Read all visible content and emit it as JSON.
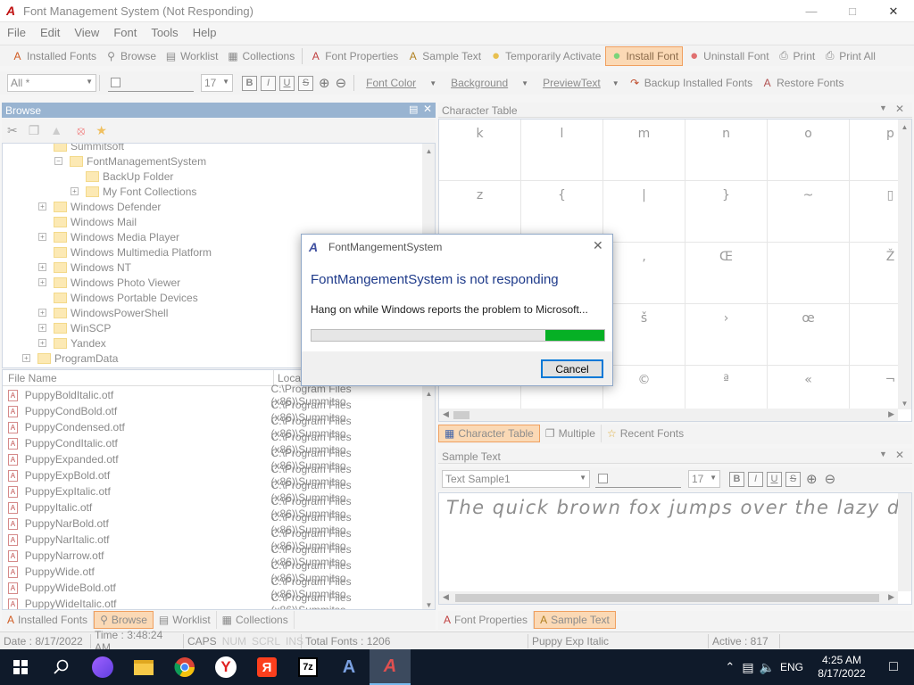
{
  "window": {
    "title": "Font Management System (Not Responding)",
    "app_icon_glyph": "A"
  },
  "menu": [
    "File",
    "Edit",
    "View",
    "Font",
    "Tools",
    "Help"
  ],
  "toolbar1": [
    {
      "label": "Installed Fonts",
      "icon": "A",
      "name": "installed-fonts"
    },
    {
      "label": "Browse",
      "icon": "🔍",
      "name": "browse"
    },
    {
      "label": "Worklist",
      "icon": "▤",
      "name": "worklist"
    },
    {
      "label": "Collections",
      "icon": "▦",
      "name": "collections"
    },
    {
      "label": "Font Properties",
      "icon": "A",
      "name": "font-properties"
    },
    {
      "label": "Sample Text",
      "icon": "A",
      "name": "sample-text"
    },
    {
      "label": "Temporarily Activate",
      "icon": "●",
      "name": "temporarily-activate"
    },
    {
      "label": "Install Font",
      "icon": "●",
      "name": "install-font"
    },
    {
      "label": "Uninstall Font",
      "icon": "●",
      "name": "uninstall-font"
    },
    {
      "label": "Print",
      "icon": "⎙",
      "name": "print"
    },
    {
      "label": "Print All",
      "icon": "⎙",
      "name": "print-all"
    }
  ],
  "toolbar2": {
    "filter_value": "All *",
    "size_value": "17",
    "format_buttons": [
      "B",
      "I",
      "U",
      "S"
    ],
    "font_color": "Font Color",
    "background": "Background",
    "preview_text": "PreviewText",
    "backup": "Backup Installed Fonts",
    "restore": "Restore Fonts"
  },
  "browse_panel": {
    "title": "Browse",
    "tree": [
      {
        "label": "Summitsoft",
        "indent": 0,
        "pm": ""
      },
      {
        "label": "FontManagementSystem",
        "indent": 1,
        "pm": "−"
      },
      {
        "label": "BackUp Folder",
        "indent": 2,
        "pm": ""
      },
      {
        "label": "My Font Collections",
        "indent": 2,
        "pm": "+"
      },
      {
        "label": "Windows Defender",
        "indent": 0,
        "pm": "+"
      },
      {
        "label": "Windows Mail",
        "indent": 0,
        "pm": ""
      },
      {
        "label": "Windows Media Player",
        "indent": 0,
        "pm": "+"
      },
      {
        "label": "Windows Multimedia Platform",
        "indent": 0,
        "pm": ""
      },
      {
        "label": "Windows NT",
        "indent": 0,
        "pm": "+"
      },
      {
        "label": "Windows Photo Viewer",
        "indent": 0,
        "pm": "+"
      },
      {
        "label": "Windows Portable Devices",
        "indent": 0,
        "pm": ""
      },
      {
        "label": "WindowsPowerShell",
        "indent": 0,
        "pm": "+"
      },
      {
        "label": "WinSCP",
        "indent": 0,
        "pm": "+"
      },
      {
        "label": "Yandex",
        "indent": 0,
        "pm": "+"
      },
      {
        "label": "ProgramData",
        "indent": -1,
        "pm": "+"
      }
    ]
  },
  "file_list": {
    "headers": [
      "File Name",
      "Locat"
    ],
    "rows": [
      {
        "name": "PuppyBoldItalic.otf",
        "path": "C:\\Program Files (x86)\\Summitso"
      },
      {
        "name": "PuppyCondBold.otf",
        "path": "C:\\Program Files (x86)\\Summitso"
      },
      {
        "name": "PuppyCondensed.otf",
        "path": "C:\\Program Files (x86)\\Summitso"
      },
      {
        "name": "PuppyCondItalic.otf",
        "path": "C:\\Program Files (x86)\\Summitso"
      },
      {
        "name": "PuppyExpanded.otf",
        "path": "C:\\Program Files (x86)\\Summitso"
      },
      {
        "name": "PuppyExpBold.otf",
        "path": "C:\\Program Files (x86)\\Summitso"
      },
      {
        "name": "PuppyExpItalic.otf",
        "path": "C:\\Program Files (x86)\\Summitso"
      },
      {
        "name": "PuppyItalic.otf",
        "path": "C:\\Program Files (x86)\\Summitso"
      },
      {
        "name": "PuppyNarBold.otf",
        "path": "C:\\Program Files (x86)\\Summitso"
      },
      {
        "name": "PuppyNarItalic.otf",
        "path": "C:\\Program Files (x86)\\Summitso"
      },
      {
        "name": "PuppyNarrow.otf",
        "path": "C:\\Program Files (x86)\\Summitso"
      },
      {
        "name": "PuppyWide.otf",
        "path": "C:\\Program Files (x86)\\Summitso"
      },
      {
        "name": "PuppyWideBold.otf",
        "path": "C:\\Program Files (x86)\\Summitso"
      },
      {
        "name": "PuppyWideItalic.otf",
        "path": "C:\\Program Files (x86)\\Summitso"
      }
    ]
  },
  "left_tabs": [
    "Installed Fonts",
    "Browse",
    "Worklist",
    "Collections"
  ],
  "char_table": {
    "title": "Character Table",
    "rows": [
      [
        "k",
        "l",
        "m",
        "n",
        "o",
        "p"
      ],
      [
        "z",
        "{",
        "|",
        "}",
        "~",
        "▯"
      ],
      [
        "",
        "",
        "‚",
        "Œ",
        "",
        "Ž"
      ],
      [
        "",
        "",
        "š",
        "›",
        "œ",
        ""
      ],
      [
        "",
        "",
        "©",
        "ª",
        "«",
        "¬"
      ]
    ]
  },
  "char_tabs": [
    "Character Table",
    "Multiple",
    "Recent Fonts"
  ],
  "sample_panel": {
    "title": "Sample Text",
    "combo": "Text Sample1",
    "size": "17",
    "text": "The quick brown fox jumps over the lazy dog"
  },
  "right_tabs": [
    "Font Properties",
    "Sample Text"
  ],
  "status": {
    "date": "Date : 8/17/2022",
    "time": "Time : 3:48:24 AM",
    "caps": "CAPS",
    "num": "NUM",
    "scrl": "SCRL",
    "ins": "INS",
    "total": "Total Fonts : 1206",
    "font": "Puppy Exp Italic",
    "active": "Active : 817"
  },
  "dialog": {
    "title": "FontMangementSystem",
    "heading": "FontMangementSystem is not responding",
    "message": "Hang on while Windows reports the problem to Microsoft...",
    "cancel": "Cancel",
    "progress": 0.2
  },
  "clock": {
    "time": "4:25 AM",
    "date": "8/17/2022"
  },
  "colors": {
    "panel_header": "#99b4d1",
    "accent_progress": "#06b025",
    "dialog_heading": "#1e3a8a"
  }
}
